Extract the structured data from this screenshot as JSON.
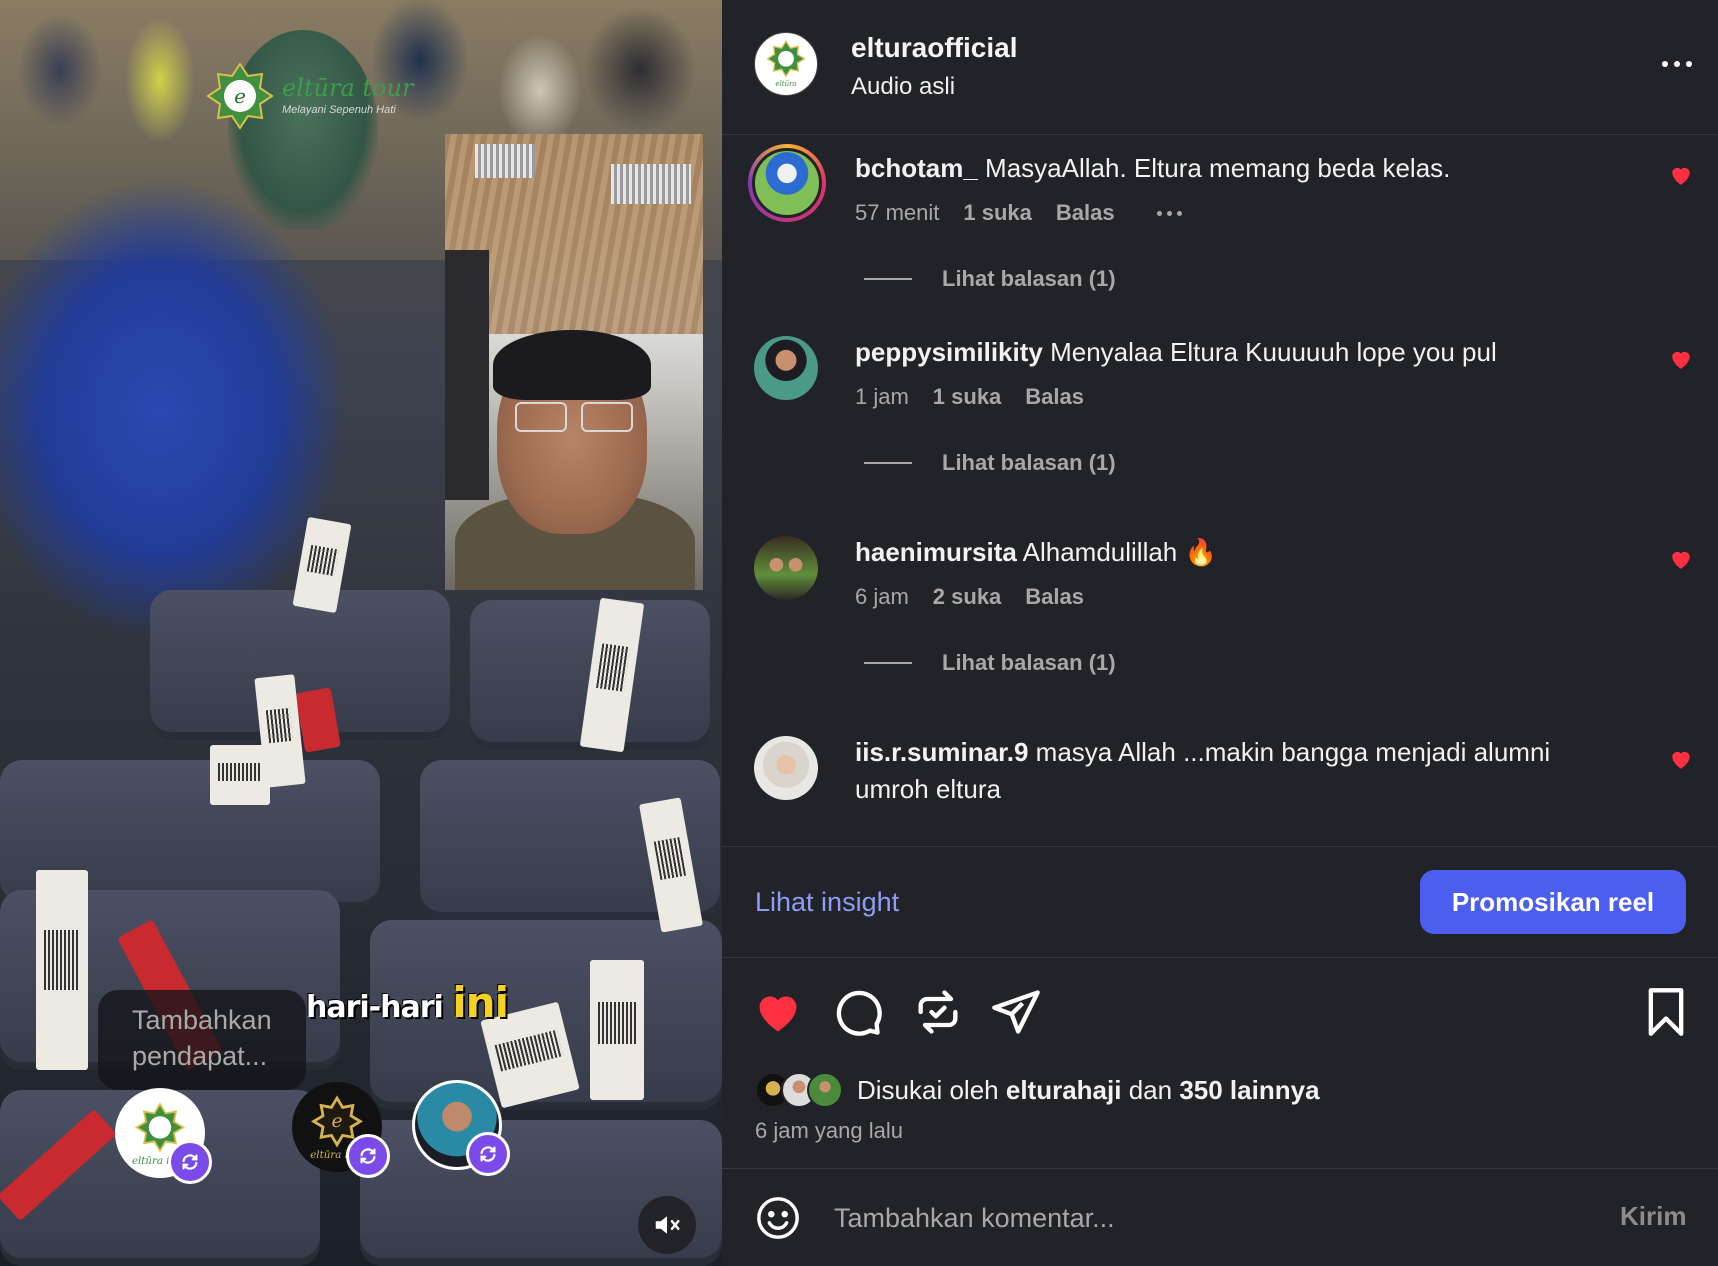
{
  "colors": {
    "panel_bg": "#212328",
    "accent_link": "#8f9cf5",
    "promote_button": "#4b5ef0",
    "like_red": "#ff3040",
    "collab_badge": "#7b4bea"
  },
  "video": {
    "watermark_name": "eltūra tour",
    "watermark_tagline": "Melayani Sepenuh Hati",
    "caption_prefix": "hari-hari",
    "caption_highlight": "ini",
    "opinion_placeholder": "Tambahkan pendapat...",
    "collaborators": [
      {
        "icon": "eltura-tour-logo"
      },
      {
        "icon": "eltura-haji-logo"
      },
      {
        "icon": "person-avatar"
      }
    ],
    "mute_icon": "speaker-muted-icon"
  },
  "header": {
    "username": "elturaofficial",
    "audio": "Audio asli",
    "more_icon": "more-horizontal-icon"
  },
  "comments": [
    {
      "username": "bchotam_",
      "text": "MasyaAllah. Eltura memang beda kelas.",
      "time": "57 menit",
      "likes": "1 suka",
      "reply": "Balas",
      "view_replies": "Lihat balasan (1)",
      "liked": true
    },
    {
      "username": "peppysimilikity",
      "text": "Menyalaa Eltura Kuuuuuh lope you pul",
      "time": "1 jam",
      "likes": "1 suka",
      "reply": "Balas",
      "view_replies": "Lihat balasan (1)",
      "liked": true
    },
    {
      "username": "haenimursita",
      "text": "Alhamdulillah 🔥",
      "time": "6 jam",
      "likes": "2 suka",
      "reply": "Balas",
      "view_replies": "Lihat balasan (1)",
      "liked": true
    },
    {
      "username": "iis.r.suminar.9",
      "text": "masya Allah ...makin bangga menjadi alumni umroh eltura",
      "liked": true
    }
  ],
  "insight": {
    "link": "Lihat insight",
    "promote": "Promosikan reel"
  },
  "actions": {
    "icons": [
      "heart-filled-icon",
      "comment-icon",
      "repost-icon",
      "share-icon",
      "bookmark-icon"
    ],
    "liked_by_prefix": "Disukai oleh",
    "liked_by_user": "elturahaji",
    "liked_by_joiner": "dan",
    "liked_by_others": "350 lainnya",
    "time_ago": "6 jam yang lalu"
  },
  "comment_box": {
    "placeholder": "Tambahkan komentar...",
    "send": "Kirim"
  }
}
